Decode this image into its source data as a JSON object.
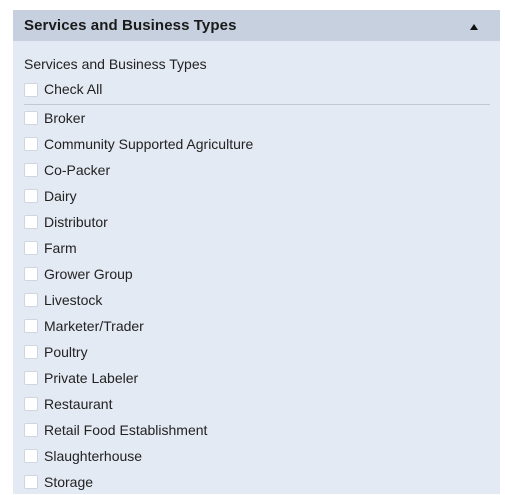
{
  "panel": {
    "title": "Services and Business Types",
    "section_label": "Services and Business Types",
    "check_all_label": "Check All",
    "items": [
      {
        "label": "Broker"
      },
      {
        "label": "Community Supported Agriculture"
      },
      {
        "label": "Co-Packer"
      },
      {
        "label": "Dairy"
      },
      {
        "label": "Distributor"
      },
      {
        "label": "Farm"
      },
      {
        "label": "Grower Group"
      },
      {
        "label": "Livestock"
      },
      {
        "label": "Marketer/Trader"
      },
      {
        "label": "Poultry"
      },
      {
        "label": "Private Labeler"
      },
      {
        "label": "Restaurant"
      },
      {
        "label": "Retail Food Establishment"
      },
      {
        "label": "Slaughterhouse"
      },
      {
        "label": "Storage"
      }
    ]
  },
  "icons": {
    "toggle": "caret-up-icon"
  },
  "colors": {
    "header_bg": "#c6d0de",
    "panel_bg": "#e4eaf3",
    "checkbox_bg": "#ffffff",
    "text": "#222222"
  }
}
